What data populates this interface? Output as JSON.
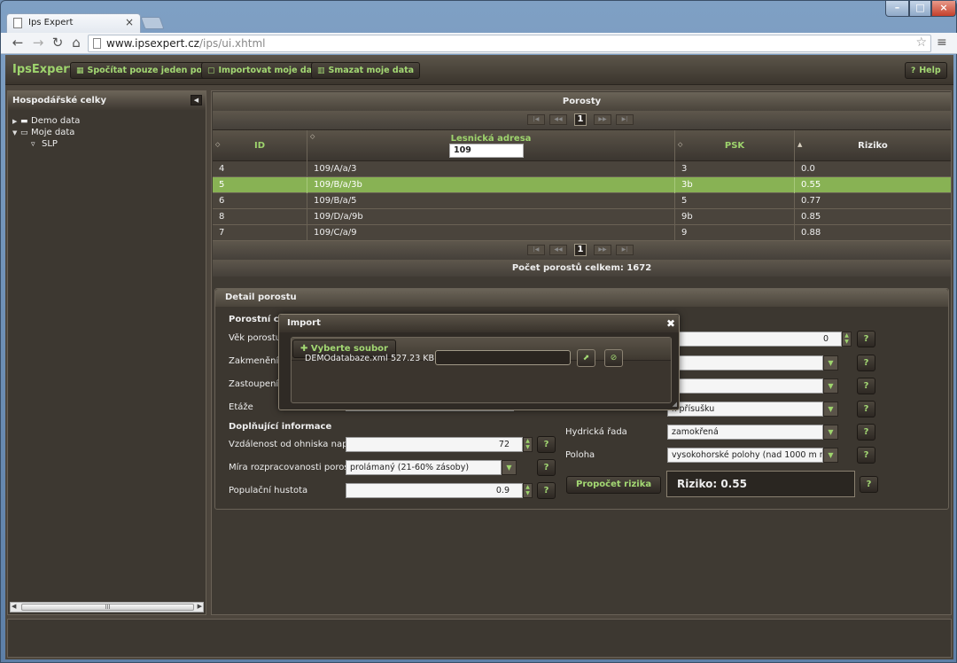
{
  "browser": {
    "tab_title": "Ips Expert",
    "url_host": "www.ipsexpert.cz",
    "url_path": "/ips/ui.xhtml"
  },
  "app": {
    "brand": "IpsExpert",
    "buttons": {
      "single": "Spočítat pouze jeden porost",
      "import": "Importovat moje data",
      "delete": "Smazat moje data",
      "help": "Help"
    }
  },
  "left": {
    "title": "Hospodářské celky",
    "tree": [
      {
        "label": "Demo data"
      },
      {
        "label": "Moje data"
      },
      {
        "label": "SLP"
      }
    ]
  },
  "grid": {
    "title": "Porosty",
    "page": "1",
    "columns": {
      "id": "ID",
      "address": "Lesnická adresa",
      "psk": "PSK",
      "risk": "Riziko"
    },
    "filter_value": "109",
    "rows": [
      {
        "id": "4",
        "address": "109/A/a/3",
        "psk": "3",
        "risk": "0.0"
      },
      {
        "id": "5",
        "address": "109/B/a/3b",
        "psk": "3b",
        "risk": "0.55"
      },
      {
        "id": "6",
        "address": "109/B/a/5",
        "psk": "5",
        "risk": "0.77"
      },
      {
        "id": "8",
        "address": "109/D/a/9b",
        "psk": "9b",
        "risk": "0.85"
      },
      {
        "id": "7",
        "address": "109/C/a/9",
        "psk": "9",
        "risk": "0.88"
      }
    ],
    "count_text": "Počet porostů celkem: 1672"
  },
  "detail": {
    "title": "Detail porostu",
    "section1": "Porostní chara",
    "labels": {
      "age": "Věk porostu",
      "stocking": "Zakmenění",
      "share": "Zastoupení",
      "stages": "Etáže"
    },
    "section2": "Doplňující informace",
    "distance_label": "Vzdálenost od ohniska napadení",
    "distance_value": "72",
    "rate_label": "Míra rozpracovanosti porostu",
    "rate_value": "prolámaný (21-60% zásoby)",
    "density_label": "Populační hustota",
    "density_value": "0.9",
    "right_age_value": "0",
    "right_stage_value": "k přísušku",
    "hydric_label": "Hydrická řada",
    "hydric_value": "zamokřená",
    "position_label": "Poloha",
    "position_value": "vysokohorské polohy (nad 1000 m n.m.)",
    "calc_button": "Propočet rizika",
    "risk_text": "Riziko: 0.55",
    "help_q": "?"
  },
  "modal": {
    "title": "Import",
    "choose": "Vyberte soubor",
    "file_name": "DEMOdatabaze.xml",
    "file_size": "527.23 KB"
  },
  "colors": {
    "accent": "#9ed46d",
    "selected_row": "#88b254",
    "panel": "#4d463d"
  }
}
